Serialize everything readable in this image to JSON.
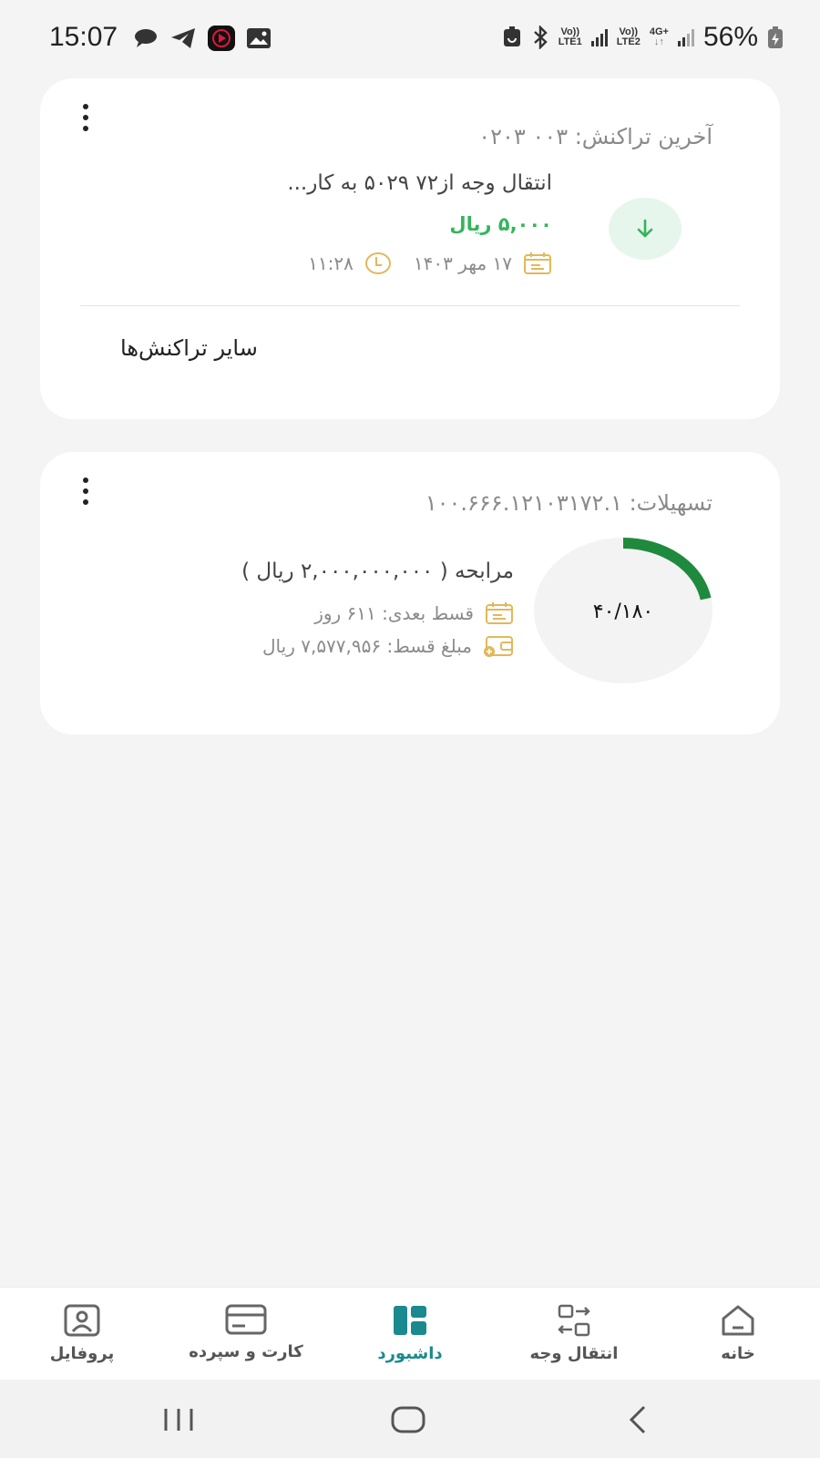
{
  "status_bar": {
    "time": "15:07",
    "battery": "56%",
    "sim1": [
      "Vo))",
      "LTE1"
    ],
    "sim2": [
      "Vo))",
      "LTE2"
    ],
    "data_type": "4G+",
    "notification_icons": [
      "chat-bubble-icon",
      "telegram-icon",
      "youtube-music-icon",
      "gallery-icon"
    ],
    "system_icons": [
      "battery-saver-icon",
      "bluetooth-icon",
      "signal-icon",
      "battery-charging-icon"
    ]
  },
  "last_transaction": {
    "title": "آخرین تراکنش: ۰۰۳      ۰۲۰۳",
    "description": "انتقال وجه از۷۲       ۵۰۲۹ به کار...",
    "amount": "۵,۰۰۰ ریال",
    "date": "۱۷ مهر ۱۴۰۳",
    "time": "۱۱:۲۸",
    "direction_icon": "arrow-down-icon",
    "other_transactions": "سایر تراکنش‌ها",
    "accent_color": "#34b55a"
  },
  "loan": {
    "title": "تسهیلات: ۱۰۰.۶۶۶.۱۲۱۰۳۱۷۲.۱",
    "type_label": "مرابحه",
    "amount_label": "( ۲,۰۰۰,۰۰۰,۰۰۰ ریال )",
    "next_installment": "قسط بعدی: ۶۱۱ روز",
    "installment_amount": "مبلغ قسط: ۷,۵۷۷,۹۵۶ ریال",
    "progress_text": "۴۰/۱۸۰",
    "paid": 40,
    "total": 180,
    "progress_color": "#1f8a3e"
  },
  "bottom_nav": {
    "items": [
      {
        "label": "پروفایل",
        "icon": "profile-icon"
      },
      {
        "label": "کارت و سپرده",
        "icon": "card-icon"
      },
      {
        "label": "داشبورد",
        "icon": "dashboard-icon",
        "active": true
      },
      {
        "label": "انتقال وجه",
        "icon": "transfer-icon"
      },
      {
        "label": "خانه",
        "icon": "home-icon"
      }
    ],
    "active_color": "#1a8a8e"
  },
  "system_nav": [
    "recent-apps-icon",
    "home-button-icon",
    "back-icon"
  ]
}
